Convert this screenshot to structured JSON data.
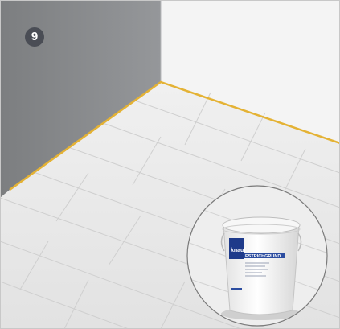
{
  "step": {
    "number": "9"
  },
  "product": {
    "brand": "knauf",
    "name": "ESTRICHGRUND"
  },
  "colors": {
    "wall_left": "#8d8f90",
    "wall_back": "#f3f3f3",
    "floor": "#eeeeee",
    "tape": "#e4b234",
    "badge": "#4a4d55",
    "brand_blue": "#1e3a8a",
    "inset_border": "#7a7a7a"
  }
}
